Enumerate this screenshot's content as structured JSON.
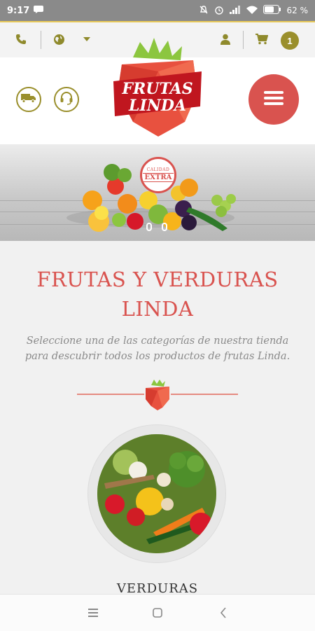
{
  "status_bar": {
    "time": "9:17",
    "battery": "62 %"
  },
  "topbar": {
    "cart_count": "1"
  },
  "logo": {
    "line1": "FRUTAS",
    "line2": "LINDA"
  },
  "hero": {
    "seal_top": "CALIDAD",
    "seal_main": "EXTRA"
  },
  "main": {
    "title": "FRUTAS Y VERDURAS LINDA",
    "subtitle": "Seleccione una de las categorías de nuestra tienda para descubrir todos los productos de frutas Linda."
  },
  "category": {
    "label": "VERDURAS"
  },
  "colors": {
    "accent": "#d9534f",
    "olive": "#9a8f2c",
    "gold": "#e9ca59"
  }
}
